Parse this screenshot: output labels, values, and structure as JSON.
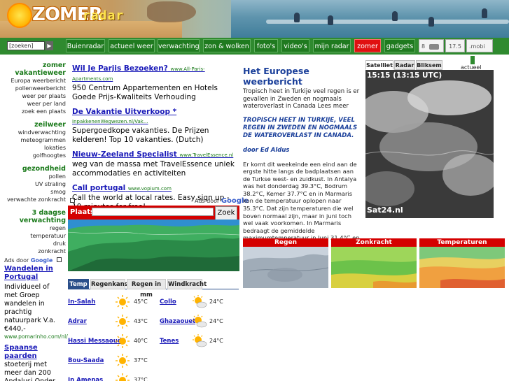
{
  "header": {
    "logo_word": "ZOMER",
    "logo_sub": "radar"
  },
  "nav": {
    "search_placeholder": "[zoeken]",
    "search_go": "▶",
    "items": [
      {
        "label": "Buienradar",
        "active": false
      },
      {
        "label": "actueel weer",
        "active": false
      },
      {
        "label": "verwachting",
        "active": false
      },
      {
        "label": "zon & wolken",
        "active": false
      },
      {
        "label": "foto's",
        "active": false
      },
      {
        "label": "video's",
        "active": false
      },
      {
        "label": "mijn radar",
        "active": false
      },
      {
        "label": "zomer",
        "active": true
      },
      {
        "label": "gadgets",
        "active": false
      }
    ],
    "extra_left": "8",
    "extra_mid": "17.5",
    "extra_right": ".mobi"
  },
  "sidebar": {
    "sections": [
      {
        "head": "zomer vakantieweer",
        "links": [
          "Europa weerbericht",
          "pollenweerbericht",
          "weer per plaats",
          "weer per land",
          "zoek een plaats"
        ]
      },
      {
        "head": "zeilweer",
        "links": [
          "windverwachting",
          "meteogrammen lokaties",
          "golfhoogtes"
        ]
      },
      {
        "head": "gezondheid",
        "links": [
          "pollen",
          "UV straling",
          "smog",
          "verwachte zonkracht"
        ]
      },
      {
        "head": "3 daagse verwachting",
        "links": [
          "regen",
          "temperatuur",
          "druk",
          "zonkracht"
        ]
      }
    ],
    "ad": {
      "ads_by": "Ads door",
      "ads_by_brand": "Google",
      "title": "Wandelen in Portugal",
      "body": "Individueel of met Groep wandelen in prachtig natuurpark V.a. €440,-",
      "url": "www.pomarinho.com/nl/",
      "title2": "Spaanse paarden",
      "body2": "stoeterij met meer dan 200 Andalusi Onder de Spaanse"
    }
  },
  "ads": [
    {
      "title": "Wil Je Parjis Bezoeken?",
      "url": "www.All-Paris-Apartments.com",
      "body": "950 Centrum Appartementen en Hotels Goede Prijs-Kwaliteits Verhouding"
    },
    {
      "title": "De Vakantie Uitverkoop *",
      "url": "InpakkenenWegwezen.nl/Vak...",
      "body": "Supergoedkope vakanties. De Prijzen kelderen! Top 10 vakanties. (Dutch)"
    },
    {
      "title": "Nieuw-Zeeland Specialist",
      "url": "www.TravelEssence.nl",
      "body": "weg van de massa met TravelEssence uniek accommodaties en activiteiten"
    },
    {
      "title": "Call portugal",
      "url": "www.vopium.com",
      "body": "Call the world at local rates. Easy sign up - 10 minutes for free!"
    }
  ],
  "ads_by_mid": {
    "text": "Ads door",
    "brand": "Google"
  },
  "mapwidget": {
    "plaats_label": "Plaats:",
    "zoek_label": "Zoek"
  },
  "forecast": {
    "tabs": [
      {
        "label": "Temp",
        "active": true
      },
      {
        "label": "Regenkans",
        "active": false
      },
      {
        "label": "Regen in mm",
        "active": false
      },
      {
        "label": "Windkracht",
        "active": false
      }
    ],
    "rows": [
      {
        "city1": "In-Salah",
        "temp1": "45°C",
        "icon1": "sun-icon",
        "city2": "Collo",
        "temp2": "24°C",
        "icon2": "partly-cloudy-icon"
      },
      {
        "city1": "Adrar",
        "temp1": "43°C",
        "icon1": "sun-icon",
        "city2": "Ghazaouet",
        "temp2": "24°C",
        "icon2": "partly-cloudy-icon"
      },
      {
        "city1": "Hassi Messaoud",
        "temp1": "40°C",
        "icon1": "sun-icon",
        "city2": "Tenes",
        "temp2": "24°C",
        "icon2": "partly-cloudy-icon"
      },
      {
        "city1": "Bou-Saada",
        "temp1": "37°C",
        "icon1": "sun-icon",
        "city2": "",
        "temp2": "",
        "icon2": ""
      },
      {
        "city1": "In Amenas",
        "temp1": "37°C",
        "icon1": "sun-icon",
        "city2": "",
        "temp2": "",
        "icon2": ""
      }
    ]
  },
  "article": {
    "title": "Het Europese weerbericht",
    "intro": "Tropisch heet in Turkije veel regen is er gevallen in Zweden en nogmaals wateroverlast in Canada Lees meer",
    "emphasis": "TROPISCH HEET IN TURKIJE, VEEL REGEN IN ZWEDEN EN NOGMAALS DE WATEROVERLAST IN CANADA.",
    "author": "door Ed Aldus",
    "body": "Er komt dit weekeinde een eind aan de ergste hitte langs de badplaatsen aan de Turkse west- en zuidkust. In Antalya was het donderdag 39.3°C, Bodrum 38.2°C, Kemer 37.7°C en in Marmaris kon de temperatuur oplopen naar 35.3°C. Dat zijn temperaturen die wel boven normaal zijn, maar in juni toch wel vaak voorkomen. In Marmaris bedraagt de gemiddelde maximumtemperatuur in Juni 31.4°C en in juli 34.4°C. (Binne"
  },
  "satellite": {
    "tabs": [
      {
        "label": "Satelliet",
        "active": true
      },
      {
        "label": "Radar",
        "active": false
      },
      {
        "label": "Bliksem",
        "active": false
      }
    ],
    "actueel": "actueel",
    "time": "15:15 (13:15 UTC)",
    "logo": "Sat24.nl"
  },
  "small_maps": [
    {
      "title": "Regen"
    },
    {
      "title": "Zonkracht"
    },
    {
      "title": "Temperaturen"
    }
  ],
  "colors": {
    "nav_green": "#2f8a2f",
    "accent_red": "#d40000",
    "link_blue": "#1a1ab8",
    "head_green": "#1a7a1a",
    "article_blue": "#1a3f9a"
  }
}
